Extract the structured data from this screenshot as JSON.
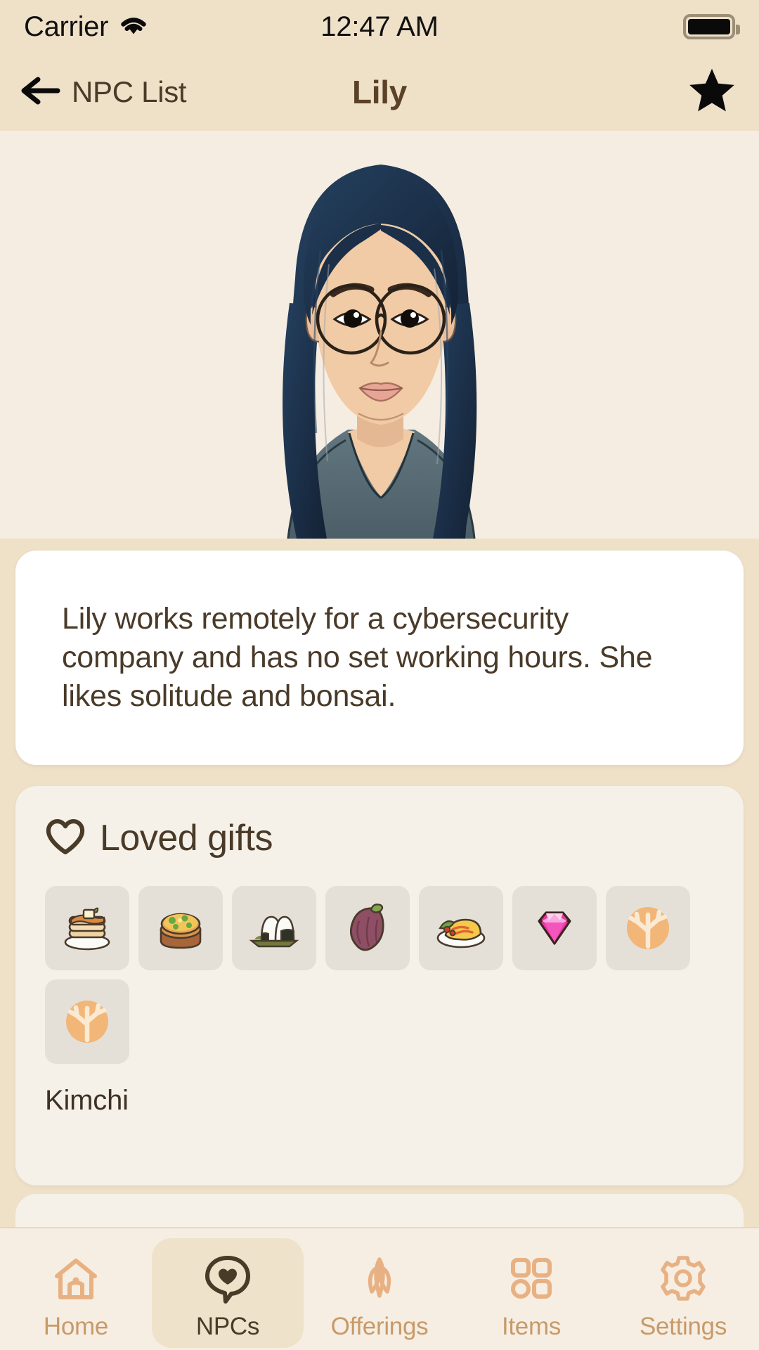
{
  "status_bar": {
    "carrier": "Carrier",
    "wifi_icon": "wifi-icon",
    "time": "12:47 AM",
    "battery_icon": "battery-full-icon"
  },
  "nav_bar": {
    "back_icon": "arrow-left-icon",
    "back_label": "NPC List",
    "title": "Lily",
    "favorite_icon": "star-filled-icon",
    "favorite_active": true
  },
  "portrait": {
    "character_name": "Lily",
    "alt": "npc-portrait-lily",
    "hair_color": "#1F3550",
    "skin_color": "#F0CBA6",
    "hoodie_color": "#5B6F79",
    "background": "#F5EDE2"
  },
  "bio_card": {
    "text": "Lily works remotely for a cybersecurity company and has no set working hours. She likes solitude and bonsai."
  },
  "gifts_card": {
    "heart_icon": "heart-outline-icon",
    "title": "Loved gifts",
    "caption": "Kimchi",
    "items": [
      {
        "name": "pancakes",
        "icon": "pancakes-icon"
      },
      {
        "name": "quiche",
        "icon": "quiche-icon"
      },
      {
        "name": "onigiri",
        "icon": "onigiri-icon"
      },
      {
        "name": "sweet-potato",
        "icon": "sweet-potato-icon"
      },
      {
        "name": "omurice",
        "icon": "omurice-icon"
      },
      {
        "name": "gem",
        "icon": "pink-gem-icon"
      },
      {
        "name": "coral-a",
        "icon": "coral-icon"
      },
      {
        "name": "coral-b",
        "icon": "coral-icon"
      }
    ]
  },
  "tab_bar": {
    "active_index": 1,
    "tabs": [
      {
        "label": "Home",
        "icon": "house-icon"
      },
      {
        "label": "NPCs",
        "icon": "speech-bubble-heart-icon"
      },
      {
        "label": "Offerings",
        "icon": "wheat-icon"
      },
      {
        "label": "Items",
        "icon": "grid-squares-icon"
      },
      {
        "label": "Settings",
        "icon": "gear-icon"
      }
    ]
  },
  "colors": {
    "page_background": "#EFE0C8",
    "card_white": "#FFFFFF",
    "card_cream": "#F5F1E8",
    "tile": "#E4E0D8",
    "text_brown": "#4A3A28",
    "accent_orange": "#E8B183",
    "tabbar_background": "#F6EEE2"
  }
}
